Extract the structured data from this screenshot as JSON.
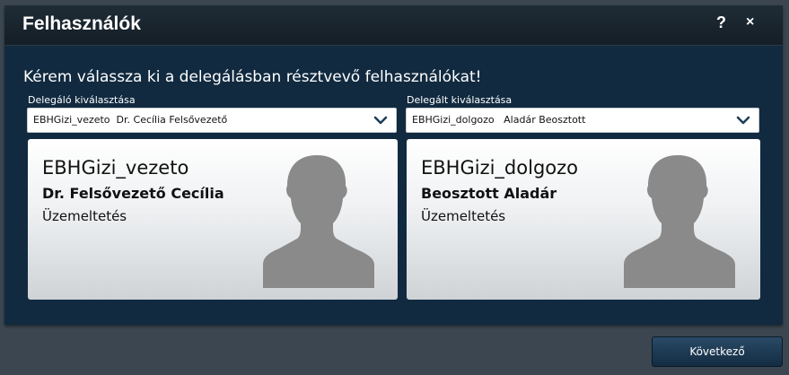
{
  "dialog": {
    "title": "Felhasználók",
    "help_label": "?",
    "close_label": "×",
    "instruction": "Kérem válassza ki a delegálásban résztvevő felhasználókat!"
  },
  "delegator": {
    "label": "Delegáló kiválasztása",
    "selected": "EBHGizi_vezeto  Dr. Cecília Felsővezető",
    "card": {
      "username": "EBHGizi_vezeto",
      "full_name": "Dr. Felsővezető Cecília",
      "department": "Üzemeltetés"
    }
  },
  "delegate": {
    "label": "Delegált kiválasztása",
    "selected": "EBHGizi_dolgozo   Aladár Beosztott",
    "card": {
      "username": "EBHGizi_dolgozo",
      "full_name": "Beosztott Aladár",
      "department": "Üzemeltetés"
    }
  },
  "footer": {
    "next_label": "Következő"
  },
  "colors": {
    "background": "#3b4650",
    "dialog": "#112a40",
    "avatar": "#8a8a8a",
    "chevron": "#1f3e5a"
  },
  "icons": {
    "dropdown": "chevron-down-icon",
    "avatar": "person-silhouette-icon"
  }
}
